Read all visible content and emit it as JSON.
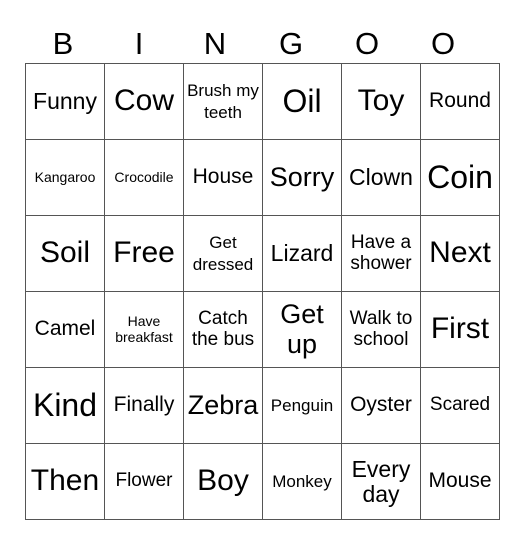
{
  "header": [
    "B",
    "I",
    "N",
    "G",
    "O",
    "O"
  ],
  "rows": [
    [
      "Funny",
      "Cow",
      "Brush my teeth",
      "Oil",
      "Toy",
      "Round"
    ],
    [
      "Kangaroo",
      "Crocodile",
      "House",
      "Sorry",
      "Clown",
      "Coin"
    ],
    [
      "Soil",
      "Free",
      "Get dressed",
      "Lizard",
      "Have a shower",
      "Next"
    ],
    [
      "Camel",
      "Have breakfast",
      "Catch the bus",
      "Get up",
      "Walk to school",
      "First"
    ],
    [
      "Kind",
      "Finally",
      "Zebra",
      "Penguin",
      "Oyster",
      "Scared"
    ],
    [
      "Then",
      "Flower",
      "Boy",
      "Monkey",
      "Every day",
      "Mouse"
    ]
  ]
}
